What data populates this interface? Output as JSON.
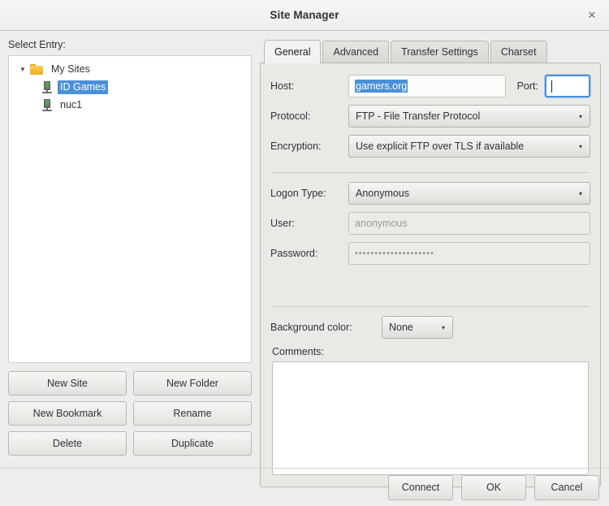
{
  "window": {
    "title": "Site Manager",
    "close_icon": "close-icon",
    "close_glyph": "✕"
  },
  "left": {
    "select_entry_label": "Select Entry:",
    "tree": {
      "expander_glyph": "▼",
      "root": {
        "label": "My Sites",
        "icon": "folder-icon",
        "expanded": true
      },
      "children": [
        {
          "label": "ID Games",
          "icon": "server-icon",
          "selected": true
        },
        {
          "label": "nuc1",
          "icon": "server-icon",
          "selected": false
        }
      ]
    },
    "buttons": [
      {
        "label": "New Site"
      },
      {
        "label": "New Folder"
      },
      {
        "label": "New Bookmark"
      },
      {
        "label": "Rename"
      },
      {
        "label": "Delete"
      },
      {
        "label": "Duplicate"
      }
    ]
  },
  "right": {
    "tabs": [
      {
        "label": "General",
        "active": true
      },
      {
        "label": "Advanced",
        "active": false
      },
      {
        "label": "Transfer Settings",
        "active": false
      },
      {
        "label": "Charset",
        "active": false
      }
    ],
    "general": {
      "host_label": "Host:",
      "host_value": "gamers.org",
      "host_selected": true,
      "port_label": "Port:",
      "port_value": "",
      "port_focused": true,
      "protocol_label": "Protocol:",
      "protocol_value": "FTP - File Transfer Protocol",
      "encryption_label": "Encryption:",
      "encryption_value": "Use explicit FTP over TLS if available",
      "logon_type_label": "Logon Type:",
      "logon_type_value": "Anonymous",
      "user_label": "User:",
      "user_value": "anonymous",
      "user_disabled": true,
      "password_label": "Password:",
      "password_value": "••••••••••••••••••••",
      "password_disabled": true,
      "background_color_label": "Background color:",
      "background_color_value": "None",
      "comments_label": "Comments:",
      "comments_value": "",
      "dropdown_arrow": "▾"
    }
  },
  "bottom": {
    "buttons": [
      {
        "label": "Connect"
      },
      {
        "label": "OK"
      },
      {
        "label": "Cancel"
      }
    ]
  },
  "colors": {
    "selection_blue": "#4a90d9",
    "dialog_bg": "#ededeb",
    "panel_bg": "#e9e9e6",
    "folder_yellow": "#eeb021",
    "led_green": "#3fae3f"
  }
}
